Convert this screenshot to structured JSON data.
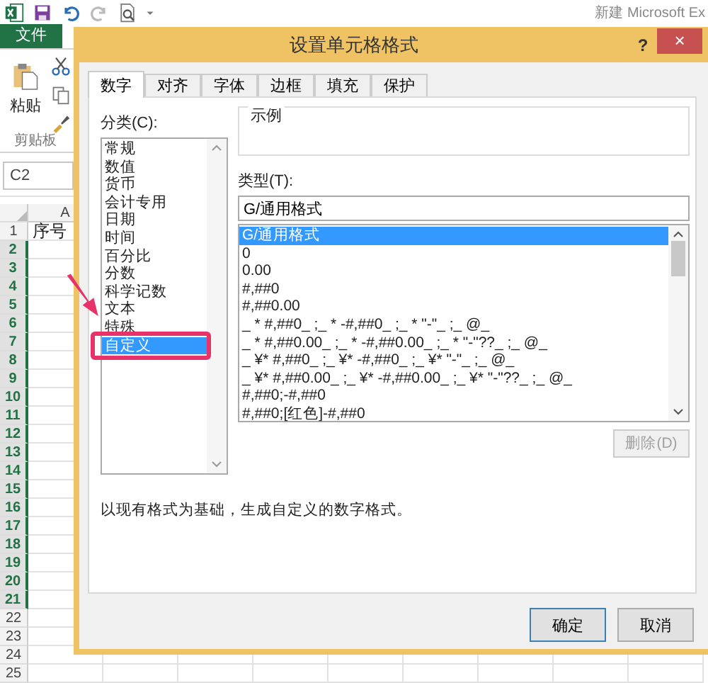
{
  "app": {
    "title": "新建 Microsoft Ex"
  },
  "ribbon": {
    "file_tab": "文件",
    "paste": "粘贴",
    "group": "剪贴板"
  },
  "name_box": "C2",
  "sheet": {
    "column_header": "A",
    "rows": [
      {
        "number": "1",
        "selected": false,
        "cell": "序号"
      },
      {
        "number": "2",
        "selected": true
      },
      {
        "number": "3",
        "selected": true
      },
      {
        "number": "4",
        "selected": true
      },
      {
        "number": "5",
        "selected": true
      },
      {
        "number": "6",
        "selected": true
      },
      {
        "number": "7",
        "selected": true
      },
      {
        "number": "8",
        "selected": true
      },
      {
        "number": "9",
        "selected": true
      },
      {
        "number": "10",
        "selected": true
      },
      {
        "number": "11",
        "selected": true
      },
      {
        "number": "12",
        "selected": true
      },
      {
        "number": "13",
        "selected": true
      },
      {
        "number": "14",
        "selected": true
      },
      {
        "number": "15",
        "selected": true
      },
      {
        "number": "16",
        "selected": true
      },
      {
        "number": "17",
        "selected": true
      },
      {
        "number": "18",
        "selected": true
      },
      {
        "number": "19",
        "selected": true
      },
      {
        "number": "20",
        "selected": true
      },
      {
        "number": "21",
        "selected": true
      },
      {
        "number": "22",
        "selected": false
      },
      {
        "number": "23",
        "selected": false
      },
      {
        "number": "24",
        "selected": false
      },
      {
        "number": "25",
        "selected": false
      }
    ]
  },
  "dialog": {
    "title": "设置单元格格式",
    "help": "?",
    "close": "×",
    "tabs": [
      {
        "label": "数字",
        "selected": true
      },
      {
        "label": "对齐",
        "selected": false
      },
      {
        "label": "字体",
        "selected": false
      },
      {
        "label": "边框",
        "selected": false
      },
      {
        "label": "填充",
        "selected": false
      },
      {
        "label": "保护",
        "selected": false
      }
    ],
    "category_label": "分类(C):",
    "categories": [
      {
        "label": "常规",
        "selected": false
      },
      {
        "label": "数值",
        "selected": false
      },
      {
        "label": "货币",
        "selected": false
      },
      {
        "label": "会计专用",
        "selected": false
      },
      {
        "label": "日期",
        "selected": false
      },
      {
        "label": "时间",
        "selected": false
      },
      {
        "label": "百分比",
        "selected": false
      },
      {
        "label": "分数",
        "selected": false
      },
      {
        "label": "科学记数",
        "selected": false
      },
      {
        "label": "文本",
        "selected": false
      },
      {
        "label": "特殊",
        "selected": false
      },
      {
        "label": "自定义",
        "selected": true,
        "highlighted": true
      }
    ],
    "sample_label": "示例",
    "type_label": "类型(T):",
    "type_value": "G/通用格式",
    "formats": [
      {
        "label": "G/通用格式",
        "selected": true
      },
      {
        "label": "0",
        "selected": false
      },
      {
        "label": "0.00",
        "selected": false
      },
      {
        "label": "#,##0",
        "selected": false
      },
      {
        "label": "#,##0.00",
        "selected": false
      },
      {
        "label": "_ * #,##0_ ;_ * -#,##0_ ;_ * \"-\"_ ;_ @_",
        "selected": false
      },
      {
        "label": "_ * #,##0.00_ ;_ * -#,##0.00_ ;_ * \"-\"??_ ;_ @_",
        "selected": false
      },
      {
        "label": "_ ¥* #,##0_ ;_ ¥* -#,##0_ ;_ ¥* \"-\"_ ;_ @_",
        "selected": false
      },
      {
        "label": "_ ¥* #,##0.00_ ;_ ¥* -#,##0.00_ ;_ ¥* \"-\"??_ ;_ @_",
        "selected": false
      },
      {
        "label": "#,##0;-#,##0",
        "selected": false
      },
      {
        "label": "#,##0;[红色]-#,##0",
        "selected": false
      }
    ],
    "delete_button": {
      "label": "删除(D)",
      "disabled": true
    },
    "description": "以现有格式为基础，生成自定义的数字格式。",
    "ok": "确定",
    "cancel": "取消"
  }
}
